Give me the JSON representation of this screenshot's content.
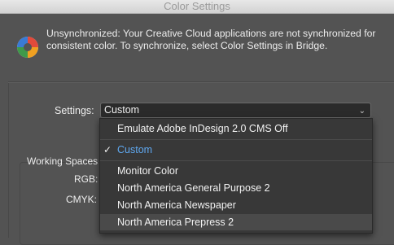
{
  "window": {
    "title": "Color Settings"
  },
  "sync": {
    "message": "Unsynchronized: Your Creative Cloud applications are not synchronized for consistent color. To synchronize, select Color Settings in Bridge.",
    "icon": "color-sync-wheel-icon"
  },
  "settings": {
    "label": "Settings:",
    "selected": "Custom"
  },
  "menu": {
    "items": [
      {
        "label": "Emulate Adobe InDesign 2.0 CMS Off",
        "checked": false
      },
      {
        "label": "Custom",
        "checked": true
      },
      {
        "label": "Monitor Color",
        "checked": false
      },
      {
        "label": "North America General Purpose 2",
        "checked": false
      },
      {
        "label": "North America Newspaper",
        "checked": false
      },
      {
        "label": "North America Prepress 2",
        "checked": false,
        "highlighted": true
      }
    ],
    "check_glyph": "✓"
  },
  "working_spaces": {
    "label": "Working Spaces",
    "rgb_label": "RGB:",
    "cmyk_label": "CMYK:"
  },
  "colors": {
    "selected_item": "#5fa8f0",
    "menu_bg": "#383838",
    "dialog_bg": "#535353"
  }
}
